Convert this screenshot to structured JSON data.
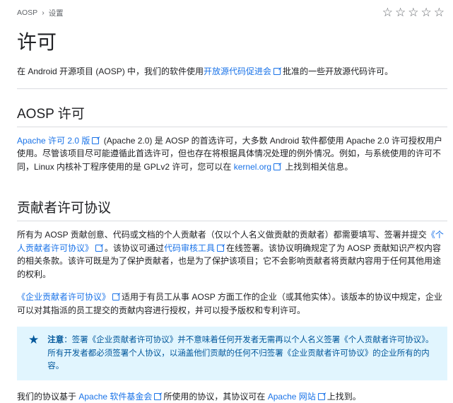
{
  "breadcrumb": {
    "root": "AOSP",
    "sep": "›",
    "current": "设置"
  },
  "rating": {
    "stars": [
      "☆",
      "☆",
      "☆",
      "☆",
      "☆"
    ]
  },
  "title": "许可",
  "intro": {
    "before": "在 Android 开源项目 (AOSP) 中，我们的软件使用",
    "link": "开放源代码促进会",
    "after": "批准的一些开放源代码许可。"
  },
  "aosp": {
    "heading": "AOSP 许可",
    "link1": "Apache 许可 2.0 版",
    "text1": " (Apache 2.0) 是 AOSP 的首选许可，大多数 Android 软件都使用 Apache 2.0 许可授权用户使用。尽管该项目尽可能遵循此首选许可，但也存在将根据具体情况处理的例外情况。例如，与系统使用的许可不同，Linux 内核补丁程序使用的是 GPLv2 许可，您可以在 ",
    "link2": "kernel.org",
    "text2": " 上找到相关信息。"
  },
  "contrib": {
    "heading": "贡献者许可协议",
    "p1a": "所有为 AOSP 贡献创意、代码或文档的个人贡献者（仅以个人名义做贡献的贡献者）都需要填写、签署并提交",
    "p1link1": "《个人贡献者许可协议》",
    "p1b": "。该协议可通过",
    "p1link2": "代码审核工具",
    "p1c": "在线签署。该协议明确规定了为 AOSP 贡献知识产权内容的相关条款。该许可既是为了保护贡献者，也是为了保护该项目；它不会影响贡献者将贡献内容用于任何其他用途的权利。",
    "p2link": "《企业贡献者许可协议》",
    "p2": "适用于有员工从事 AOSP 方面工作的企业（或其他实体）。该版本的协议中规定，企业可以对其指派的员工提交的贡献内容进行授权，并可以授予版权和专利许可。"
  },
  "note": {
    "label": "注意",
    "text": "：签署《企业贡献者许可协议》并不意味着任何开发者无需再以个人名义签署《个人贡献者许可协议》。所有开发者都必须签署个人协议，以涵盖他们贡献的任何不归签署《企业贡献者许可协议》的企业所有的内容。"
  },
  "footer": {
    "a": "我们的协议基于 ",
    "link1": "Apache 软件基金会",
    "b": "所使用的协议，其协议可在 ",
    "link2": "Apache 网站",
    "c": "上找到。"
  }
}
